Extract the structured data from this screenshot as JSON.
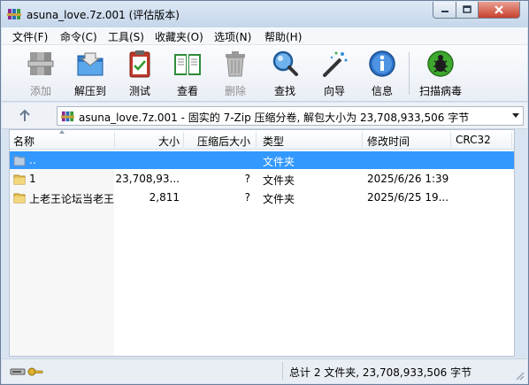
{
  "window": {
    "title": "asuna_love.7z.001 (评估版本)"
  },
  "menu": [
    {
      "label": "文件(F)"
    },
    {
      "label": "命令(C)"
    },
    {
      "label": "工具(S)"
    },
    {
      "label": "收藏夹(O)"
    },
    {
      "label": "选项(N)"
    },
    {
      "label": "帮助(H)"
    }
  ],
  "toolbar": {
    "add": {
      "label": "添加",
      "icon": "books-icon",
      "enabled": false
    },
    "extract": {
      "label": "解压到",
      "icon": "folder-extract-icon"
    },
    "test": {
      "label": "测试",
      "icon": "clipboard-check-icon"
    },
    "view": {
      "label": "查看",
      "icon": "open-book-icon"
    },
    "delete": {
      "label": "删除",
      "icon": "trash-icon",
      "enabled": false
    },
    "find": {
      "label": "查找",
      "icon": "magnifier-icon"
    },
    "wizard": {
      "label": "向导",
      "icon": "magic-wand-icon"
    },
    "info": {
      "label": "信息",
      "icon": "info-icon"
    },
    "virus_scan": {
      "label": "扫描病毒",
      "icon": "bug-icon"
    }
  },
  "address": {
    "path": "asuna_love.7z.001 - 固实的 7-Zip 压缩分卷, 解包大小为 23,708,933,506 字节"
  },
  "columns": {
    "name": "名称",
    "size": "大小",
    "packed": "压缩后大小",
    "type": "类型",
    "modified": "修改时间",
    "crc": "CRC32"
  },
  "rows": [
    {
      "name": "..",
      "size": "",
      "packed": "",
      "type": "文件夹",
      "modified": "",
      "selected": true
    },
    {
      "name": "1",
      "size": "23,708,93...",
      "packed": "?",
      "type": "文件夹",
      "modified": "2025/6/26 1:39"
    },
    {
      "name": "上老王论坛当老王",
      "size": "2,811",
      "packed": "?",
      "type": "文件夹",
      "modified": "2025/6/25 19..."
    }
  ],
  "status": {
    "summary": "总计 2 文件夹, 23,708,933,506 字节"
  },
  "colors": {
    "selection": "#3399ff",
    "window_bg": "#d8e4f1",
    "close_button": "#c9412c"
  }
}
